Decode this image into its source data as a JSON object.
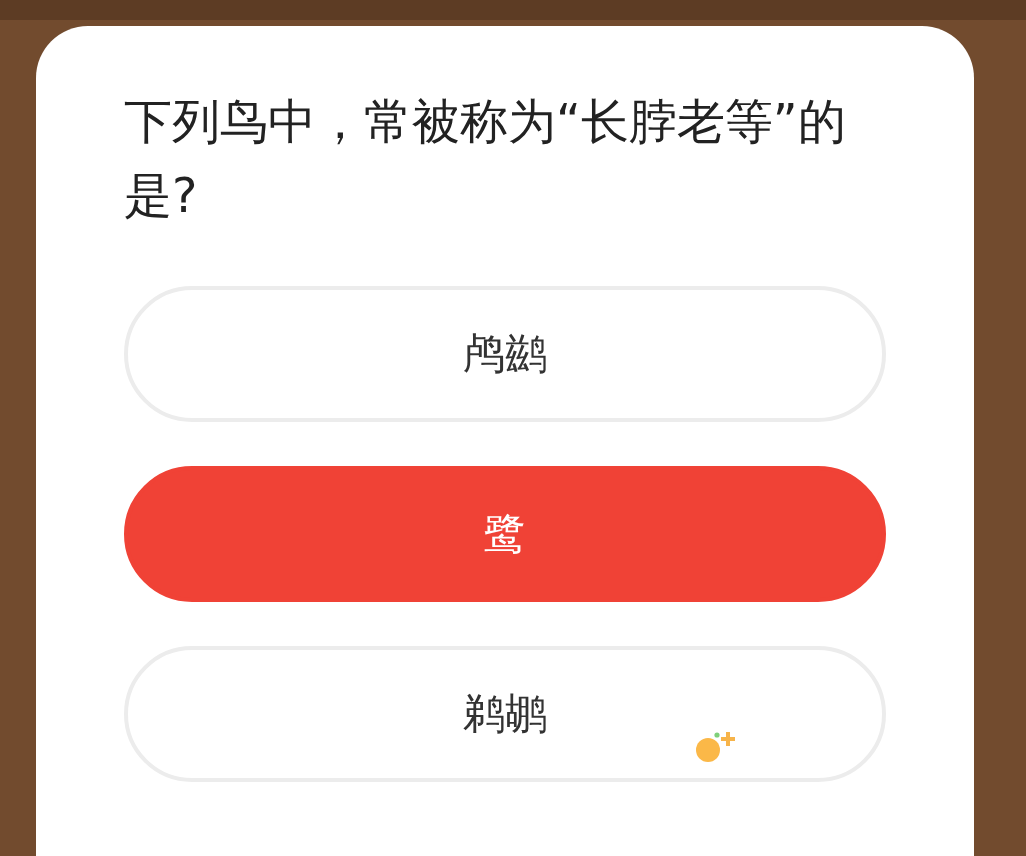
{
  "question": "下列鸟中，常被称为“长脖老等”的是?",
  "options": [
    {
      "label": "鸬鹚",
      "selected": false
    },
    {
      "label": "鹭",
      "selected": true
    },
    {
      "label": "鹈鹕",
      "selected": false
    }
  ]
}
